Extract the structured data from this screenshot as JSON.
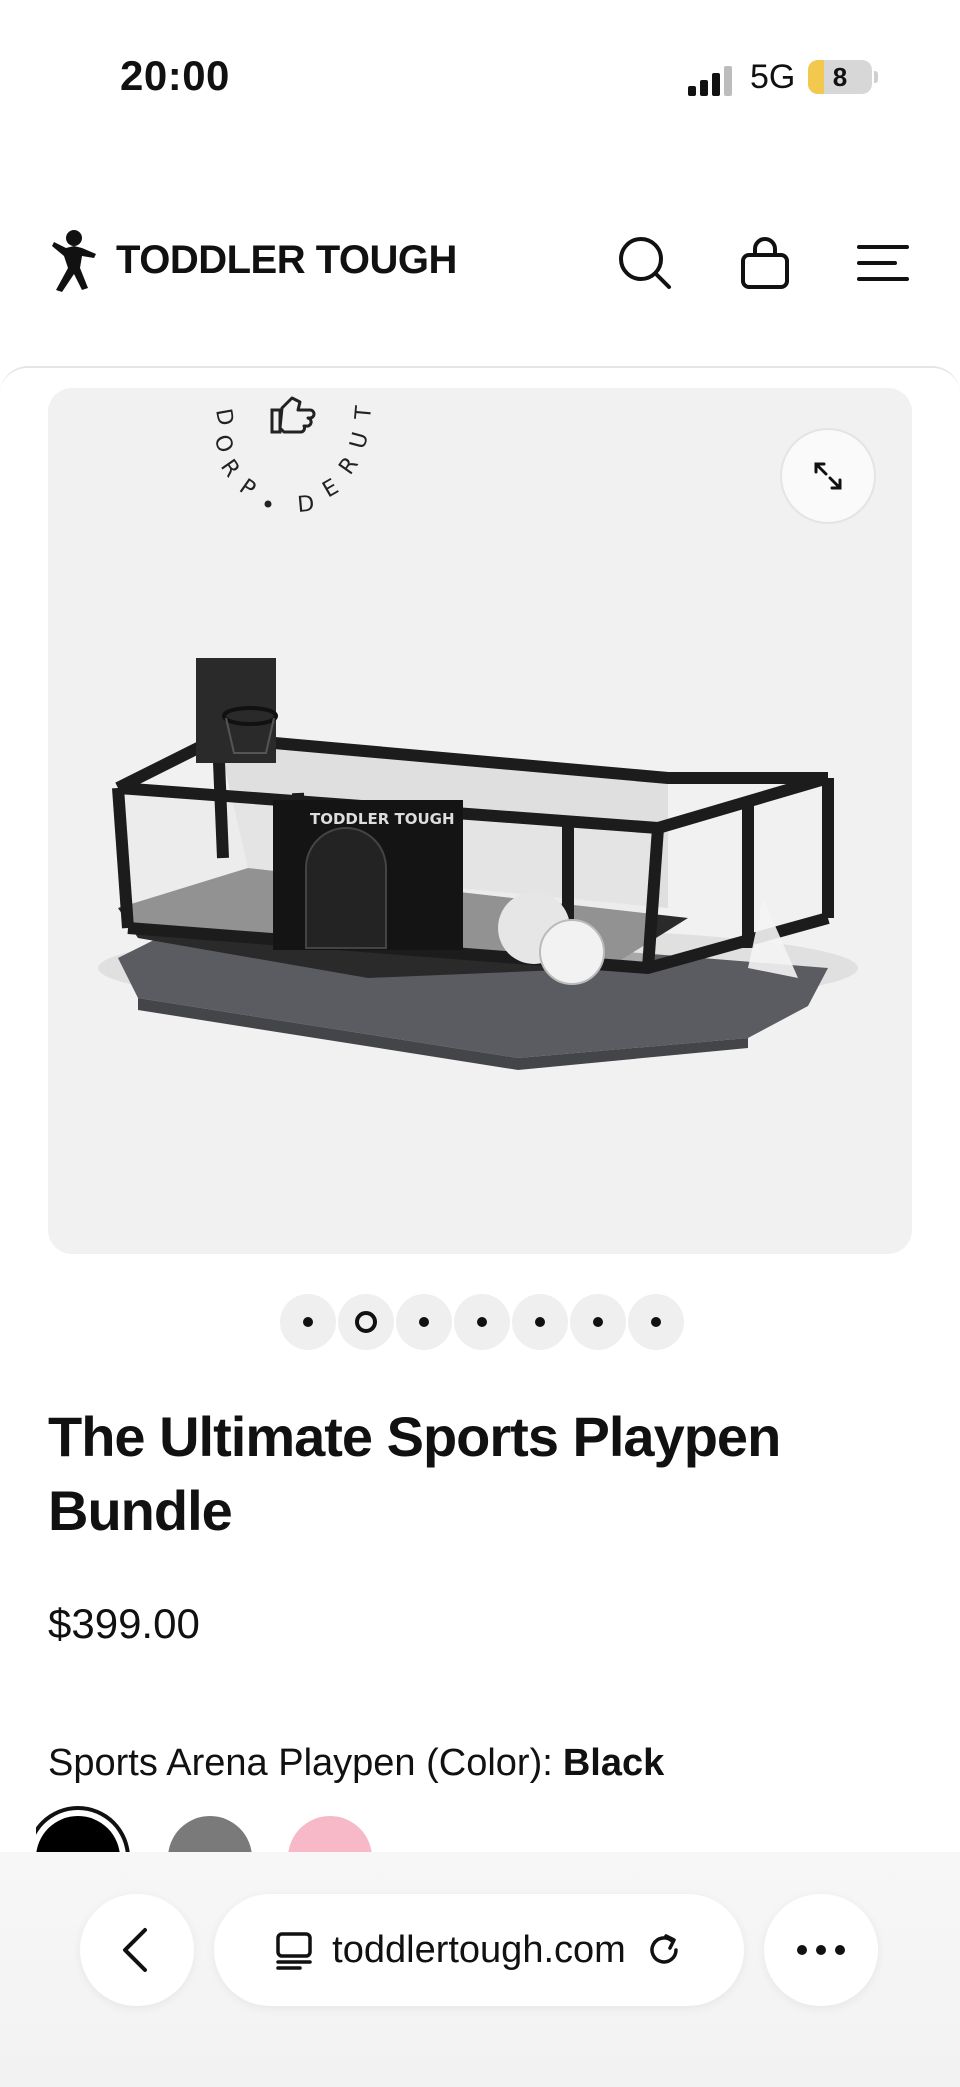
{
  "status_bar": {
    "time": "20:00",
    "network": "5G",
    "battery": "8"
  },
  "header": {
    "brand": "TODDLER TOUGH"
  },
  "gallery": {
    "badge_text": "PROD • D E R U T",
    "product_brand": "TODDLER TOUGH",
    "dots_count": 7,
    "active_dot": 2
  },
  "product": {
    "title": "The Ultimate Sports Playpen Bundle",
    "price": "$399.00",
    "option_label": "Sports Arena Playpen (Color):",
    "option_value": "Black",
    "swatch_colors": [
      "#000000",
      "#7a7a7a",
      "#f7b8c8"
    ]
  },
  "browser": {
    "url": "toddlertough.com"
  }
}
